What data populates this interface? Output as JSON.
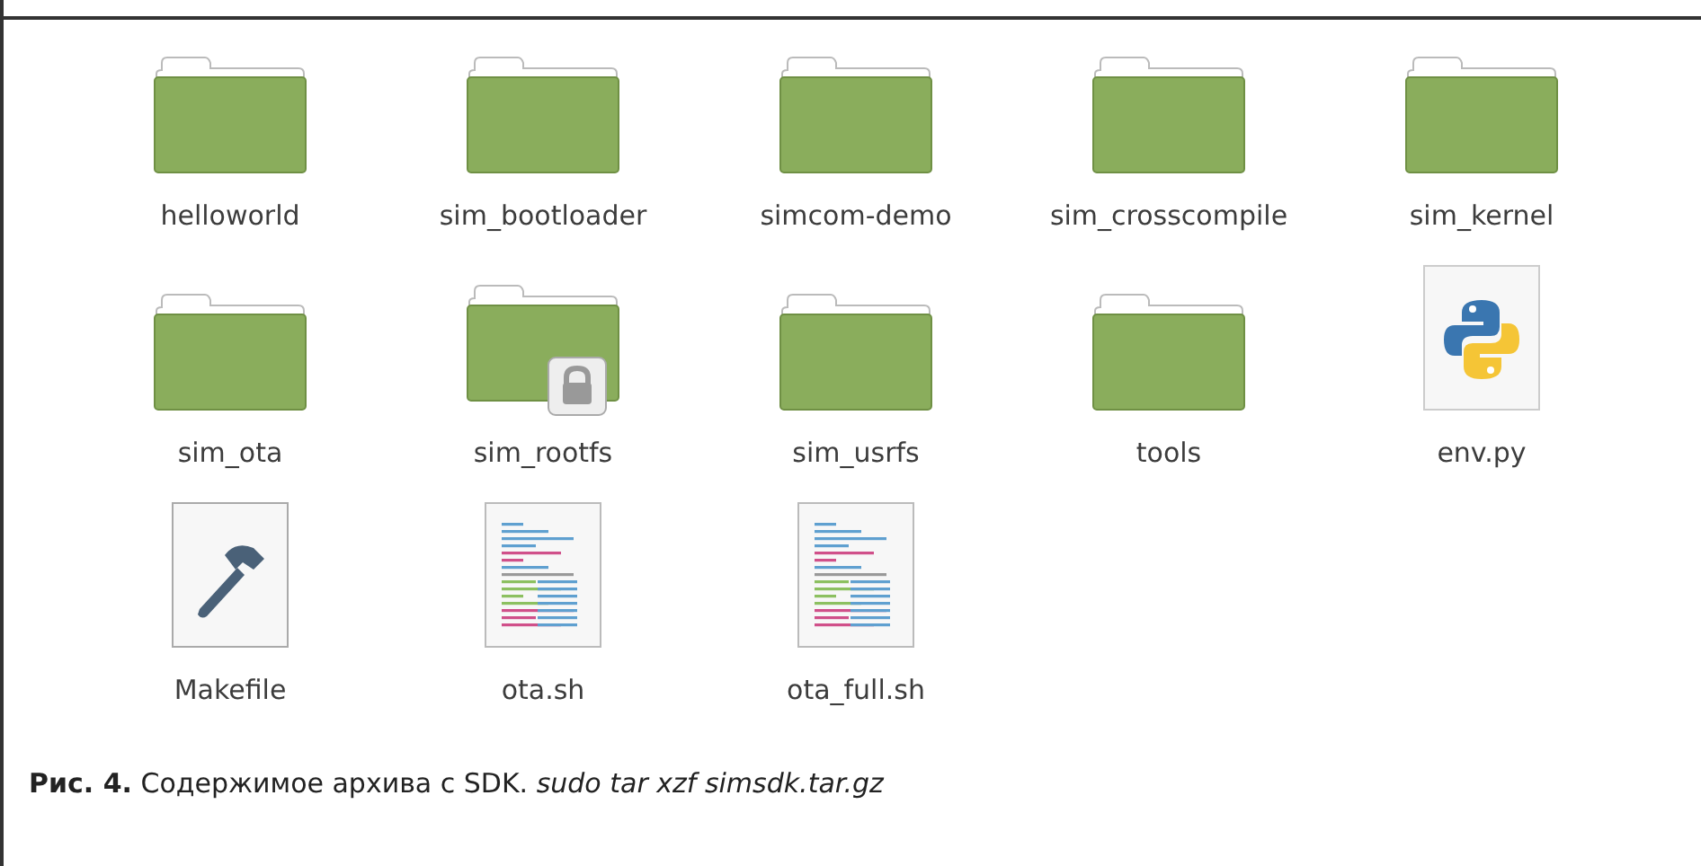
{
  "files": [
    {
      "name": "helloworld",
      "kind": "folder",
      "locked": false
    },
    {
      "name": "sim_bootloader",
      "kind": "folder",
      "locked": false
    },
    {
      "name": "simcom-demo",
      "kind": "folder",
      "locked": false
    },
    {
      "name": "sim_crosscompile",
      "kind": "folder",
      "locked": false
    },
    {
      "name": "sim_kernel",
      "kind": "folder",
      "locked": false
    },
    {
      "name": "sim_ota",
      "kind": "folder",
      "locked": false
    },
    {
      "name": "sim_rootfs",
      "kind": "folder",
      "locked": true
    },
    {
      "name": "sim_usrfs",
      "kind": "folder",
      "locked": false
    },
    {
      "name": "tools",
      "kind": "folder",
      "locked": false
    },
    {
      "name": "env.py",
      "kind": "python",
      "locked": false
    },
    {
      "name": "Makefile",
      "kind": "makefile",
      "locked": false
    },
    {
      "name": "ota.sh",
      "kind": "script",
      "locked": false
    },
    {
      "name": "ota_full.sh",
      "kind": "script",
      "locked": false
    }
  ],
  "caption": "**Рис. 4.** Содержимое архива с SDK. *sudo tar xzf simsdk.tar.gz*"
}
